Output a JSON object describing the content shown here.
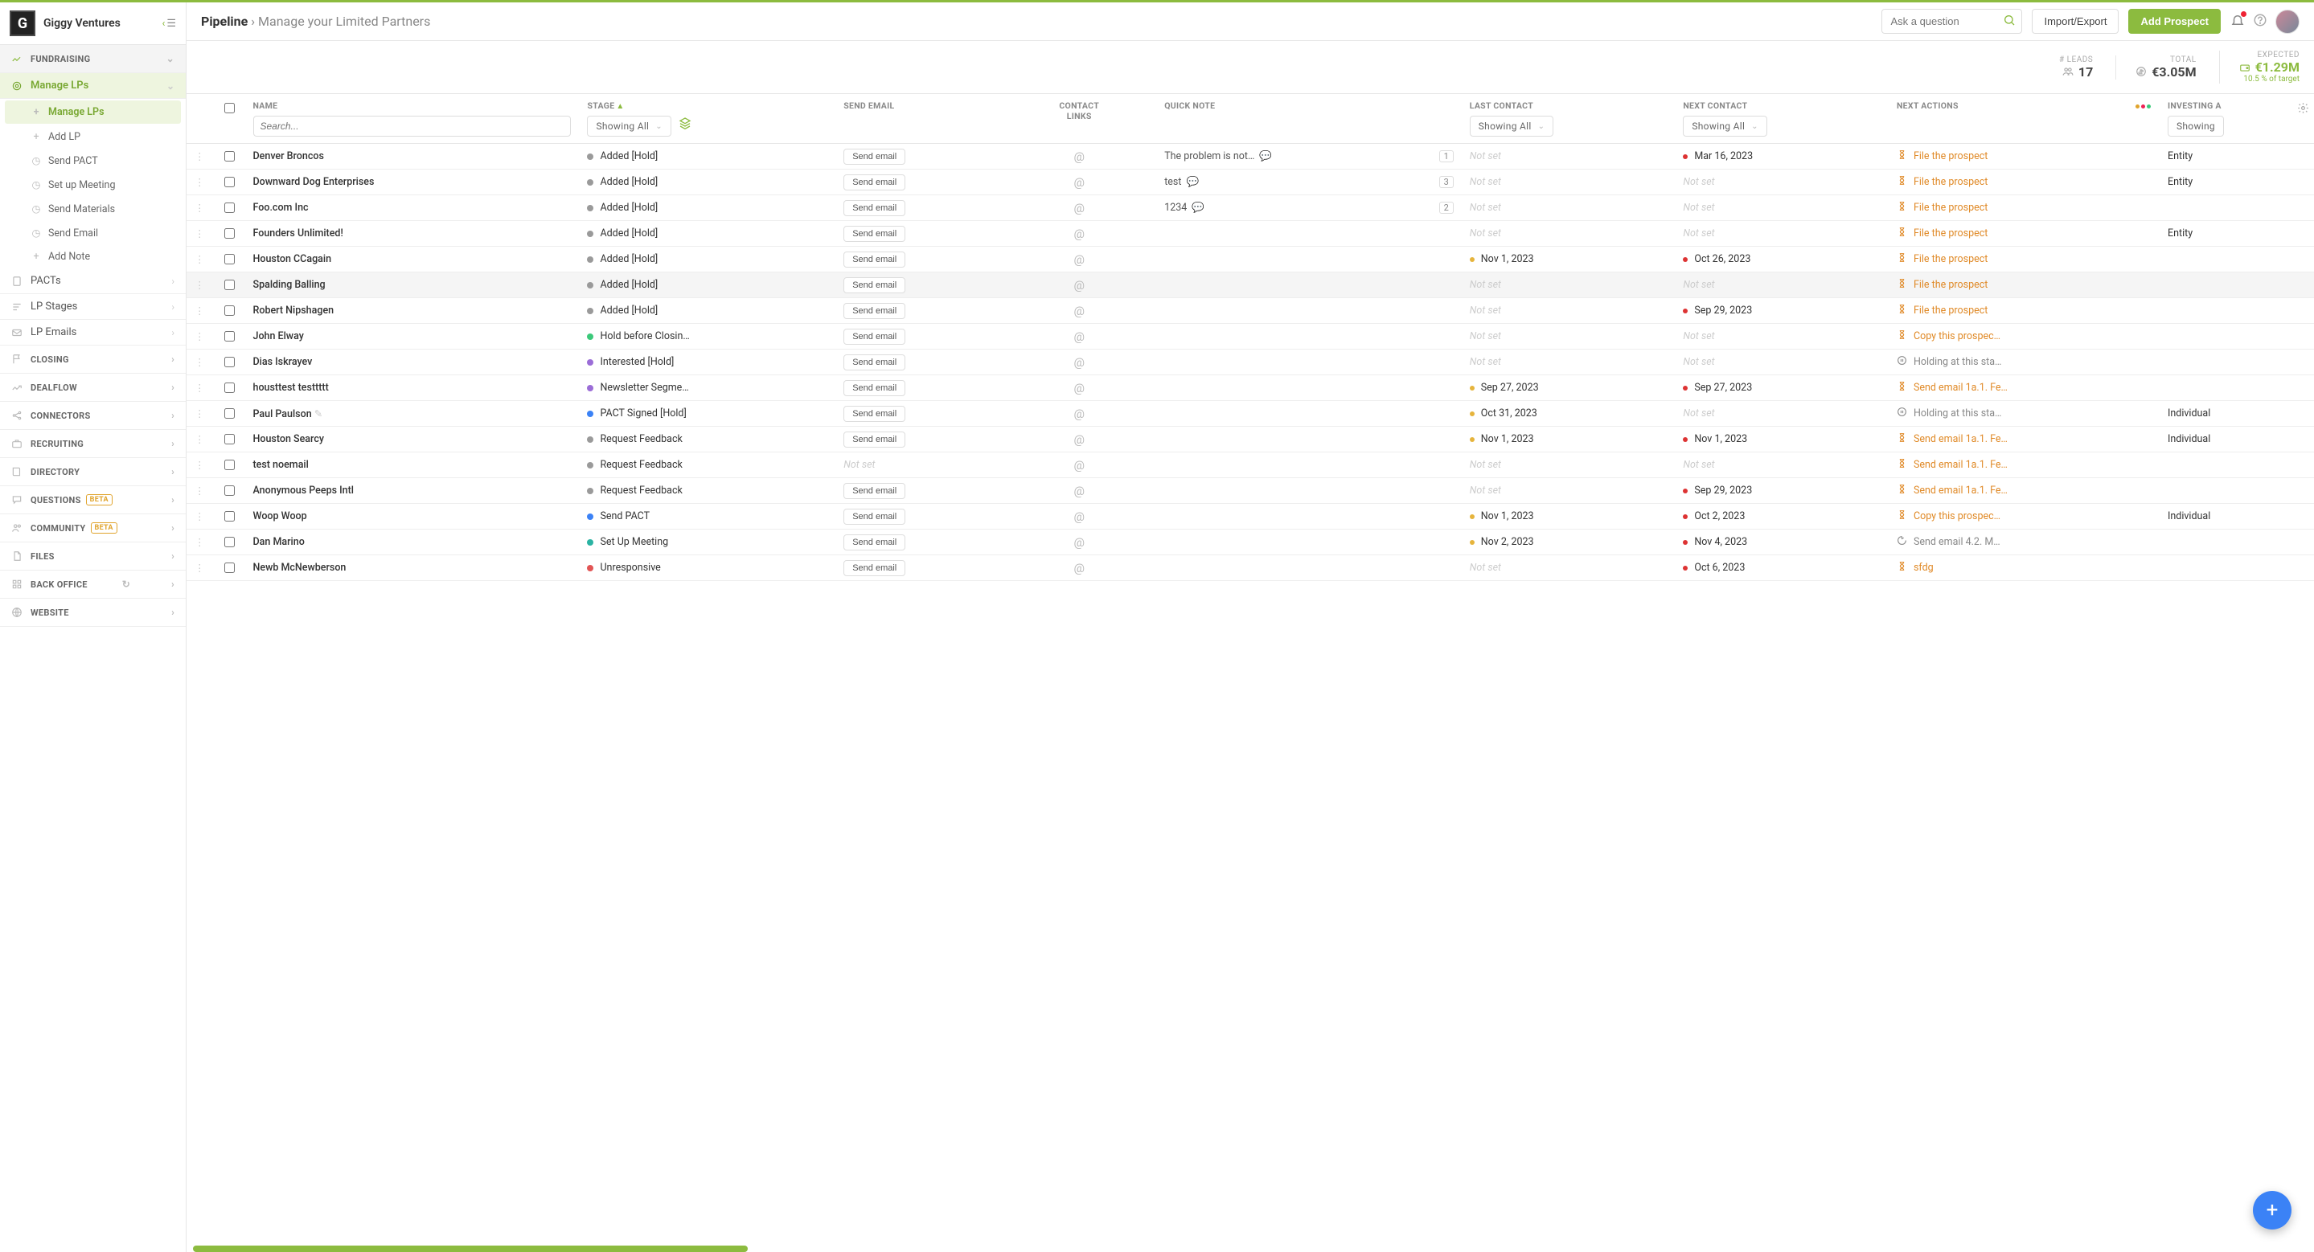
{
  "brand": {
    "name": "Giggy Ventures",
    "logo_letter": "G"
  },
  "topbar": {
    "breadcrumb_root": "Pipeline",
    "breadcrumb_page": "Manage your Limited Partners",
    "search_placeholder": "Ask a question",
    "import_export": "Import/Export",
    "add_prospect": "Add Prospect"
  },
  "sidebar": {
    "fundraising": "FUNDRAISING",
    "manage_lps": "Manage LPs",
    "subs": [
      {
        "label": "Manage LPs",
        "active": true,
        "icon": "plus"
      },
      {
        "label": "Add LP",
        "icon": "plus"
      },
      {
        "label": "Send PACT",
        "icon": "clock"
      },
      {
        "label": "Set up Meeting",
        "icon": "clock"
      },
      {
        "label": "Send Materials",
        "icon": "clock"
      },
      {
        "label": "Send Email",
        "icon": "clock"
      },
      {
        "label": "Add Note",
        "icon": "plus"
      }
    ],
    "pacts": "PACTs",
    "lp_stages": "LP Stages",
    "lp_emails": "LP Emails",
    "sections": [
      {
        "label": "CLOSING",
        "icon": "flag"
      },
      {
        "label": "DEALFLOW",
        "icon": "trend"
      },
      {
        "label": "CONNECTORS",
        "icon": "share"
      },
      {
        "label": "RECRUITING",
        "icon": "briefcase"
      },
      {
        "label": "DIRECTORY",
        "icon": "book"
      },
      {
        "label": "QUESTIONS",
        "icon": "chat",
        "badge": "BETA"
      },
      {
        "label": "COMMUNITY",
        "icon": "users",
        "badge": "BETA"
      },
      {
        "label": "FILES",
        "icon": "file"
      },
      {
        "label": "BACK OFFICE",
        "icon": "grid",
        "refresh": true
      },
      {
        "label": "WEBSITE",
        "icon": "globe"
      }
    ]
  },
  "stats": {
    "leads_label": "# LEADS",
    "leads_value": "17",
    "total_label": "TOTAL",
    "total_value": "€3.05M",
    "expected_label": "EXPECTED",
    "expected_value": "€1.29M",
    "expected_sub": "10.5 % of target"
  },
  "columns": {
    "name": "NAME",
    "name_search": "Search...",
    "stage": "STAGE",
    "stage_filter": "Showing All",
    "send_email": "SEND EMAIL",
    "contact_links": "CONTACT LINKS",
    "quick_note": "QUICK NOTE",
    "last_contact": "LAST CONTACT",
    "last_filter": "Showing All",
    "next_contact": "NEXT CONTACT",
    "next_filter": "Showing All",
    "next_actions": "NEXT ACTIONS",
    "investing": "INVESTING A",
    "investing_filter": "Showing"
  },
  "labels": {
    "send_email_btn": "Send email",
    "not_set": "Not set"
  },
  "actions": {
    "file": "File the prospect",
    "copy": "Copy this prospec…",
    "holding": "Holding at this sta…",
    "send1a1": "Send email 1a.1. Fe…",
    "send1a1b": "Send email 1a.1. Fe…",
    "send42": "Send email 4.2. M…",
    "sfdg": "sfdg"
  },
  "stage_colors": {
    "grey": "#9a9a9a",
    "green": "#3bc97a",
    "purple": "#9b6dd7",
    "blue": "#3b82f6",
    "teal": "#2bb3a3",
    "red": "#e25555"
  },
  "rows": [
    {
      "name": "Denver Broncos",
      "stage": "Added [Hold]",
      "sc": "grey",
      "email": true,
      "note": "The problem is not…",
      "ncount": "1",
      "last": "",
      "lc": "",
      "next": "Mar 16, 2023",
      "nc": "red",
      "action": "file",
      "atype": "o",
      "inv": "Entity"
    },
    {
      "name": "Downward Dog Enterprises",
      "stage": "Added [Hold]",
      "sc": "grey",
      "email": true,
      "note": "test",
      "ncount": "3",
      "last": "",
      "lc": "",
      "next": "",
      "nc": "",
      "action": "file",
      "atype": "o",
      "inv": "Entity"
    },
    {
      "name": "Foo.com Inc",
      "stage": "Added [Hold]",
      "sc": "grey",
      "email": true,
      "note": "1234",
      "ncount": "2",
      "last": "",
      "lc": "",
      "next": "",
      "nc": "",
      "action": "file",
      "atype": "o",
      "inv": ""
    },
    {
      "name": "Founders Unlimited!",
      "stage": "Added [Hold]",
      "sc": "grey",
      "email": true,
      "note": "",
      "ncount": "",
      "last": "",
      "lc": "",
      "next": "",
      "nc": "",
      "action": "file",
      "atype": "o",
      "inv": "Entity"
    },
    {
      "name": "Houston CCagain",
      "stage": "Added [Hold]",
      "sc": "grey",
      "email": true,
      "note": "",
      "ncount": "",
      "last": "Nov 1, 2023",
      "lc": "yellow",
      "next": "Oct 26, 2023",
      "nc": "red",
      "action": "file",
      "atype": "o",
      "inv": ""
    },
    {
      "name": "Spalding Balling",
      "stage": "Added [Hold]",
      "sc": "grey",
      "email": true,
      "note": "",
      "ncount": "",
      "last": "",
      "lc": "",
      "next": "",
      "nc": "",
      "action": "file",
      "atype": "o",
      "inv": "",
      "sel": true
    },
    {
      "name": "Robert Nipshagen",
      "stage": "Added [Hold]",
      "sc": "grey",
      "email": true,
      "note": "",
      "ncount": "",
      "last": "",
      "lc": "",
      "next": "Sep 29, 2023",
      "nc": "red",
      "action": "file",
      "atype": "o",
      "inv": ""
    },
    {
      "name": "John Elway",
      "stage": "Hold before Closin…",
      "sc": "green",
      "email": true,
      "note": "",
      "ncount": "",
      "last": "",
      "lc": "",
      "next": "",
      "nc": "",
      "action": "copy",
      "atype": "o",
      "inv": ""
    },
    {
      "name": "Dias Iskrayev",
      "stage": "Interested [Hold]",
      "sc": "purple",
      "email": true,
      "note": "",
      "ncount": "",
      "last": "",
      "lc": "",
      "next": "",
      "nc": "",
      "action": "holding",
      "atype": "g",
      "inv": ""
    },
    {
      "name": "housttest testtttt",
      "stage": "Newsletter Segme…",
      "sc": "purple",
      "email": true,
      "note": "",
      "ncount": "",
      "last": "Sep 27, 2023",
      "lc": "yellow",
      "next": "Sep 27, 2023",
      "nc": "red",
      "action": "send1a1",
      "atype": "o",
      "inv": ""
    },
    {
      "name": "Paul Paulson",
      "stage": "PACT Signed [Hold]",
      "sc": "blue",
      "email": true,
      "note": "",
      "ncount": "",
      "last": "Oct 31, 2023",
      "lc": "yellow",
      "next": "",
      "nc": "",
      "action": "holding",
      "atype": "g",
      "inv": "Individual",
      "noteico": true
    },
    {
      "name": "Houston Searcy",
      "stage": "Request Feedback",
      "sc": "grey",
      "email": true,
      "note": "",
      "ncount": "",
      "last": "Nov 1, 2023",
      "lc": "yellow",
      "next": "Nov 1, 2023",
      "nc": "red",
      "action": "send1a1",
      "atype": "o",
      "inv": "Individual"
    },
    {
      "name": "test noemail",
      "stage": "Request Feedback",
      "sc": "grey",
      "email": false,
      "note": "",
      "ncount": "",
      "last": "",
      "lc": "",
      "next": "",
      "nc": "",
      "action": "send1a1b",
      "atype": "o",
      "inv": ""
    },
    {
      "name": "Anonymous Peeps Intl",
      "stage": "Request Feedback",
      "sc": "grey",
      "email": true,
      "note": "",
      "ncount": "",
      "last": "",
      "lc": "",
      "next": "Sep 29, 2023",
      "nc": "red",
      "action": "send1a1",
      "atype": "o",
      "inv": ""
    },
    {
      "name": "Woop Woop",
      "stage": "Send PACT",
      "sc": "blue",
      "email": true,
      "note": "",
      "ncount": "",
      "last": "Nov 1, 2023",
      "lc": "yellow",
      "next": "Oct 2, 2023",
      "nc": "red",
      "action": "copy",
      "atype": "o",
      "inv": "Individual"
    },
    {
      "name": "Dan Marino",
      "stage": "Set Up Meeting",
      "sc": "teal",
      "email": true,
      "note": "",
      "ncount": "",
      "last": "Nov 2, 2023",
      "lc": "yellow",
      "next": "Nov 4, 2023",
      "nc": "red",
      "action": "send42",
      "atype": "g",
      "inv": ""
    },
    {
      "name": "Newb McNewberson",
      "stage": "Unresponsive",
      "sc": "red",
      "email": true,
      "note": "",
      "ncount": "",
      "last": "",
      "lc": "",
      "next": "Oct 6, 2023",
      "nc": "red",
      "action": "sfdg",
      "atype": "o",
      "inv": ""
    }
  ]
}
